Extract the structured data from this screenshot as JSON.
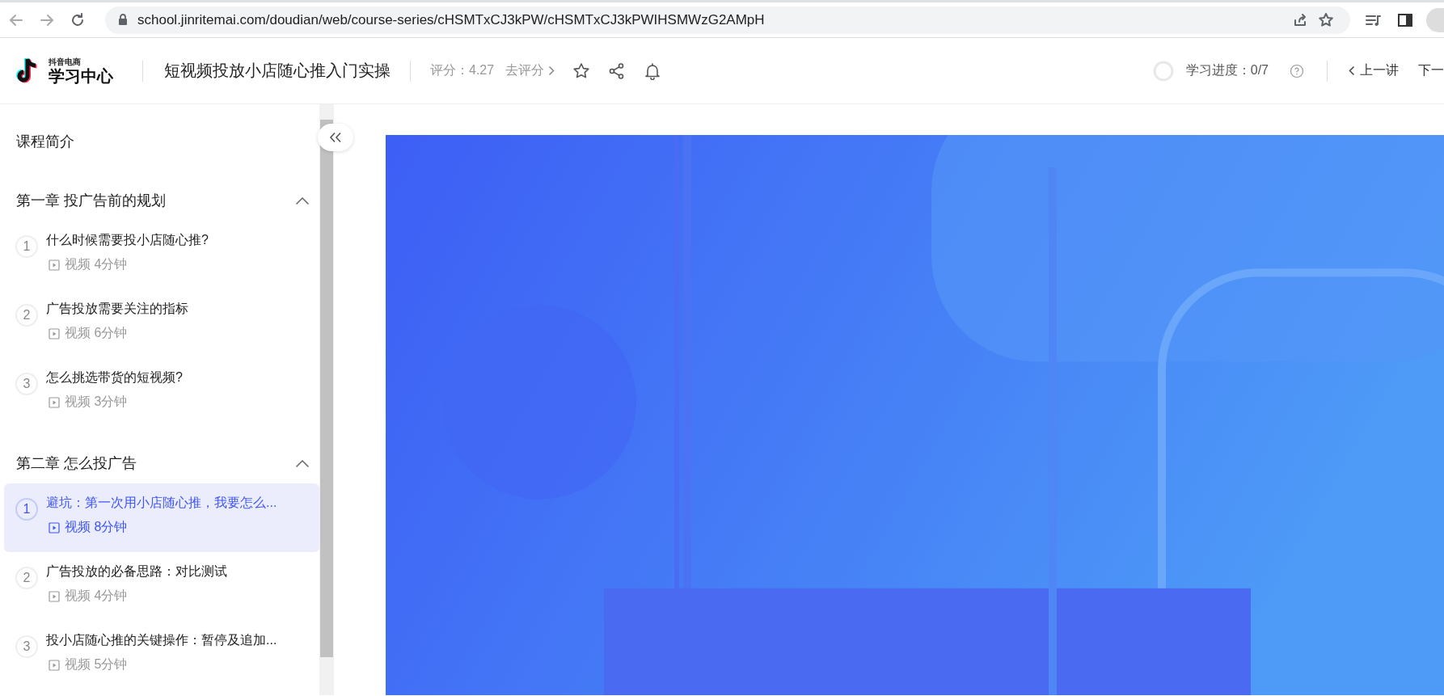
{
  "browser": {
    "url": "school.jinritemai.com/doudian/web/course-series/cHSMTxCJ3kPW/cHSMTxCJ3kPWIHSMWzG2AMpH"
  },
  "header": {
    "logo": {
      "small": "抖音电商",
      "large": "学习中心"
    },
    "course_title": "短视频投放小店随心推入门实操",
    "rating": "评分：4.27",
    "rate_link": "去评分",
    "progress": {
      "label": "学习进度：0/7",
      "level": 0
    },
    "prev": "上一讲",
    "next": "下一"
  },
  "sidebar": {
    "intro": "课程简介",
    "chapters": [
      {
        "title": "第一章 投广告前的规划",
        "expanded": true,
        "lessons": [
          {
            "number": "1",
            "title": "什么时候需要投小店随心推?",
            "meta": "视频 4分钟",
            "selected": false
          },
          {
            "number": "2",
            "title": "广告投放需要关注的指标",
            "meta": "视频 6分钟",
            "selected": false
          },
          {
            "number": "3",
            "title": "怎么挑选带货的短视频?",
            "meta": "视频 3分钟",
            "selected": false
          }
        ]
      },
      {
        "title": "第二章 怎么投广告",
        "expanded": true,
        "lessons": [
          {
            "number": "1",
            "title": "避坑：第一次用小店随心推，我要怎么...",
            "meta": "视频 8分钟",
            "selected": true
          },
          {
            "number": "2",
            "title": "广告投放的必备思路：对比测试",
            "meta": "视频 4分钟",
            "selected": false
          },
          {
            "number": "3",
            "title": "投小店随心推的关键操作：暂停及追加...",
            "meta": "视频 5分钟",
            "selected": false
          }
        ]
      }
    ]
  }
}
